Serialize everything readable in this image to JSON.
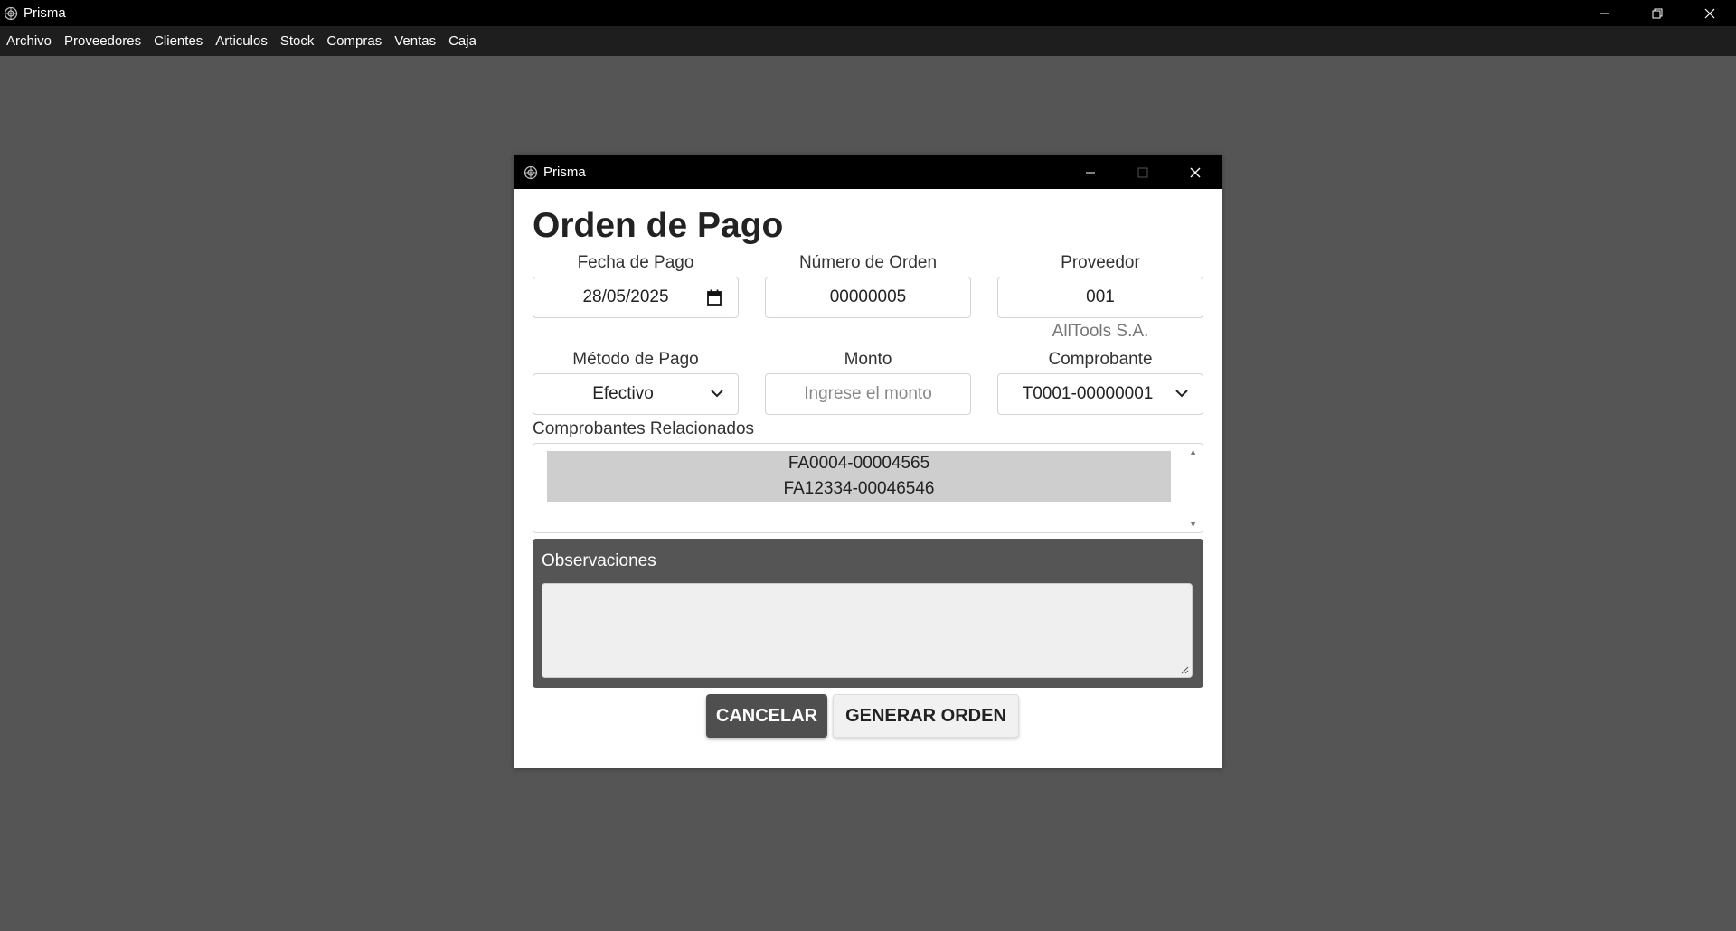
{
  "window": {
    "title": "Prisma",
    "controls": [
      "minimize-icon",
      "restore-icon",
      "close-icon"
    ]
  },
  "menu": {
    "items": [
      "Archivo",
      "Proveedores",
      "Clientes",
      "Articulos",
      "Stock",
      "Compras",
      "Ventas",
      "Caja"
    ]
  },
  "dialog": {
    "title": "Prisma",
    "heading": "Orden de Pago",
    "fecha_label": "Fecha de Pago",
    "fecha_value": "28/05/2025",
    "numero_label": "Número de Orden",
    "numero_value": "00000005",
    "proveedor_label": "Proveedor",
    "proveedor_value": "001",
    "proveedor_name": "AllTools S.A.",
    "metodo_label": "Método de Pago",
    "metodo_value": "Efectivo",
    "monto_label": "Monto",
    "monto_placeholder": "Ingrese el monto",
    "comprobante_label": "Comprobante",
    "comprobante_value": "T0001-00000001",
    "relacionados_label": "Comprobantes Relacionados",
    "relacionados": [
      "FA0004-00004565",
      "FA12334-00046546"
    ],
    "observaciones_label": "Observaciones",
    "observaciones_value": "",
    "cancel_label": "CANCELAR",
    "generate_label": "GENERAR ORDEN"
  }
}
